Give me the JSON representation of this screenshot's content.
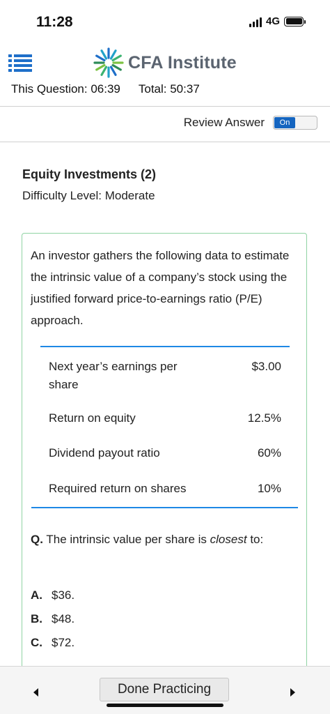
{
  "status_bar": {
    "time": "11:28",
    "network": "4G"
  },
  "header": {
    "brand": "CFA Institute",
    "icons": {
      "menu": "hamburger-menu-icon",
      "logo": "cfa-globe-logo"
    }
  },
  "timers": {
    "this_question": "This Question: 06:39",
    "total": "Total: 50:37"
  },
  "review": {
    "label": "Review Answer",
    "toggle_state": "On"
  },
  "topic": {
    "title": "Equity Investments (2)",
    "difficulty": "Difficulty Level: Moderate"
  },
  "question": {
    "prompt": "An investor gathers the following data to estimate the intrinsic value of a company’s stock using the justified forward price-to-earnings ratio (P/E) approach.",
    "table": [
      {
        "label": "Next year’s earnings per share",
        "value": "$3.00"
      },
      {
        "label": "Return on equity",
        "value": "12.5%"
      },
      {
        "label": "Dividend payout ratio",
        "value": "60%"
      },
      {
        "label": "Required return on shares",
        "value": "10%"
      }
    ],
    "q_prefix": "Q.",
    "q_text_before": "The intrinsic value per share is",
    "q_emphasis": "closest",
    "q_text_after": "to:",
    "options": [
      {
        "letter": "A.",
        "text": "$36."
      },
      {
        "letter": "B.",
        "text": "$48."
      },
      {
        "letter": "C.",
        "text": "$72."
      }
    ]
  },
  "footer": {
    "done_label": "Done Practicing"
  },
  "colors": {
    "accent_blue": "#1e88e5",
    "toggle_blue": "#1565c0",
    "card_border": "#8fd3a3",
    "brand_gray": "#5b6470"
  }
}
